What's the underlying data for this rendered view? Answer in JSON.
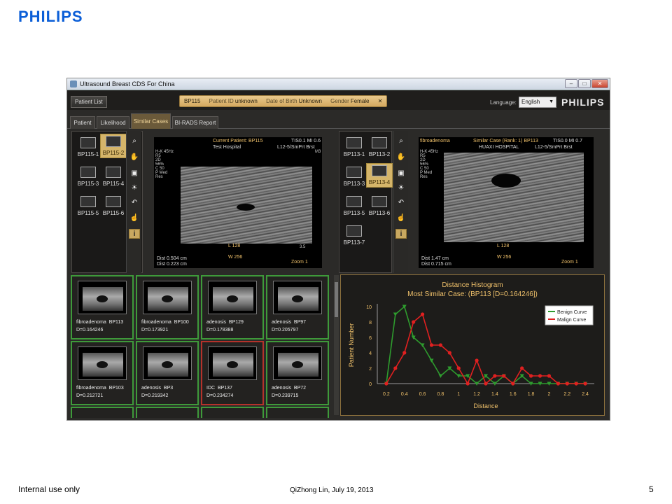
{
  "slide": {
    "brand": "PHILIPS",
    "footer_left": "Internal use only",
    "footer_center": "QiZhong Lin, July 19, 2013",
    "page_number": "5"
  },
  "window": {
    "title": "Ultrasound Breast CDS For China",
    "controls": [
      "–",
      "□",
      "✕"
    ]
  },
  "topbar": {
    "patient_list_label": "Patient List",
    "patient_tag": {
      "id": "BP115",
      "patient_id_label": "Patient ID",
      "patient_id_value": "unknown",
      "dob_label": "Date of Birth",
      "dob_value": "Unknown",
      "gender_label": "Gender",
      "gender_value": "Female",
      "close": "✕"
    },
    "language_label": "Language:",
    "language_value": "English",
    "brand": "PHILIPS"
  },
  "tabs": [
    "Patient",
    "Likelihood",
    "Similar Cases",
    "BI-RADS Report"
  ],
  "active_tab": "Similar Cases",
  "current_patient": {
    "thumbs": [
      "BP115-1",
      "BP115-2",
      "BP115-3",
      "BP115-4",
      "BP115-5",
      "BP115-6"
    ],
    "selected": "BP115-2",
    "header": "Current Patient: BP115",
    "hospital": "Test Hospital",
    "probe": "L12-5/SmPrt Brst",
    "tis": "TIS0.1  MI 0.6",
    "params": "H-K 45Hz\nR5\n2D\n56%\nC 50\nP Med\nRes",
    "L": "L    128",
    "W": "W    256",
    "zoom": "Zoom  1",
    "dist1": "Dist  0.504 cm",
    "dist2": "Dist  0.223 cm",
    "scale_top": "M3",
    "scale_bottom": "3.5"
  },
  "similar_case": {
    "thumbs": [
      "BP113-1",
      "BP113-2",
      "BP113-3",
      "BP113-4",
      "BP113-5",
      "BP113-6",
      "BP113-7"
    ],
    "selected": "BP113-4",
    "diagnosis": "fibroadenoma",
    "header": "Similar Case (Rank: 1) BP113",
    "hospital": "HUAXI HOSPITAL",
    "probe": "L12-5/SmPrt Brst",
    "tis": "TIS0.0  MI 0.7",
    "params": "H-K 45Hz\nR5\n2D\n56%\nC 50\nP Med\nRes",
    "L": "L    128",
    "W": "W    256",
    "zoom": "Zoom  1",
    "dist1": "Dist  1.47 cm",
    "dist2": "Dist  0.715 cm"
  },
  "tools": [
    "magnify-icon",
    "hand-icon",
    "lock-icon",
    "brightness-icon",
    "undo-icon",
    "hand-pointer-icon",
    "info-icon"
  ],
  "cases": [
    {
      "diag": "fibroadenoma",
      "id": "BP113",
      "d": "D=0.164246",
      "border": "green"
    },
    {
      "diag": "fibroadenoma",
      "id": "BP100",
      "d": "D=0.173921",
      "border": "green"
    },
    {
      "diag": "adenosis",
      "id": "BP129",
      "d": "D=0.178388",
      "border": "green"
    },
    {
      "diag": "adenosis",
      "id": "BP97",
      "d": "D=0.205797",
      "border": "green"
    },
    {
      "diag": "fibroadenoma",
      "id": "BP103",
      "d": "D=0.212721",
      "border": "green"
    },
    {
      "diag": "adenosis",
      "id": "BP3",
      "d": "D=0.219342",
      "border": "green"
    },
    {
      "diag": "IDC",
      "id": "BP137",
      "d": "D=0.234274",
      "border": "red"
    },
    {
      "diag": "adenosis",
      "id": "BP72",
      "d": "D=0.239715",
      "border": "green"
    }
  ],
  "colors": {
    "benign": "#2e9c2e",
    "malign": "#e02020",
    "accent": "#f1c26b"
  },
  "chart_data": {
    "type": "line",
    "title": "Distance Histogram",
    "subtitle": "Most Similar Case:  (BP113 [D=0.164246])",
    "xlabel": "Distance",
    "ylabel": "Patient Number",
    "xlim": [
      0.1,
      2.5
    ],
    "ylim": [
      0,
      10
    ],
    "xticks": [
      0.2,
      0.4,
      0.6,
      0.8,
      1,
      1.2,
      1.4,
      1.6,
      1.8,
      2,
      2.2,
      2.4
    ],
    "yticks": [
      0,
      2,
      4,
      6,
      8,
      10
    ],
    "legend_position": "top-right",
    "series": [
      {
        "name": "Benign Curve",
        "color": "#2e9c2e",
        "marker": "triangle-down",
        "x": [
          0.2,
          0.3,
          0.4,
          0.5,
          0.6,
          0.7,
          0.8,
          0.9,
          1.0,
          1.1,
          1.2,
          1.3,
          1.4,
          1.5,
          1.6,
          1.7,
          1.8,
          1.9,
          2.0,
          2.1,
          2.2,
          2.3,
          2.4
        ],
        "y": [
          0,
          9,
          10,
          6,
          5,
          3,
          1,
          2,
          1,
          1,
          0,
          1,
          0,
          1,
          0,
          1,
          0,
          0,
          0,
          0,
          0,
          0,
          0
        ]
      },
      {
        "name": "Malign Curve",
        "color": "#e02020",
        "marker": "circle",
        "x": [
          0.2,
          0.3,
          0.4,
          0.5,
          0.6,
          0.7,
          0.8,
          0.9,
          1.0,
          1.1,
          1.2,
          1.3,
          1.4,
          1.5,
          1.6,
          1.7,
          1.8,
          1.9,
          2.0,
          2.1,
          2.2,
          2.3,
          2.4
        ],
        "y": [
          0,
          2,
          4,
          8,
          9,
          5,
          5,
          4,
          2,
          0,
          3,
          0,
          1,
          1,
          0,
          2,
          1,
          1,
          1,
          0,
          0,
          0,
          0
        ]
      }
    ]
  }
}
